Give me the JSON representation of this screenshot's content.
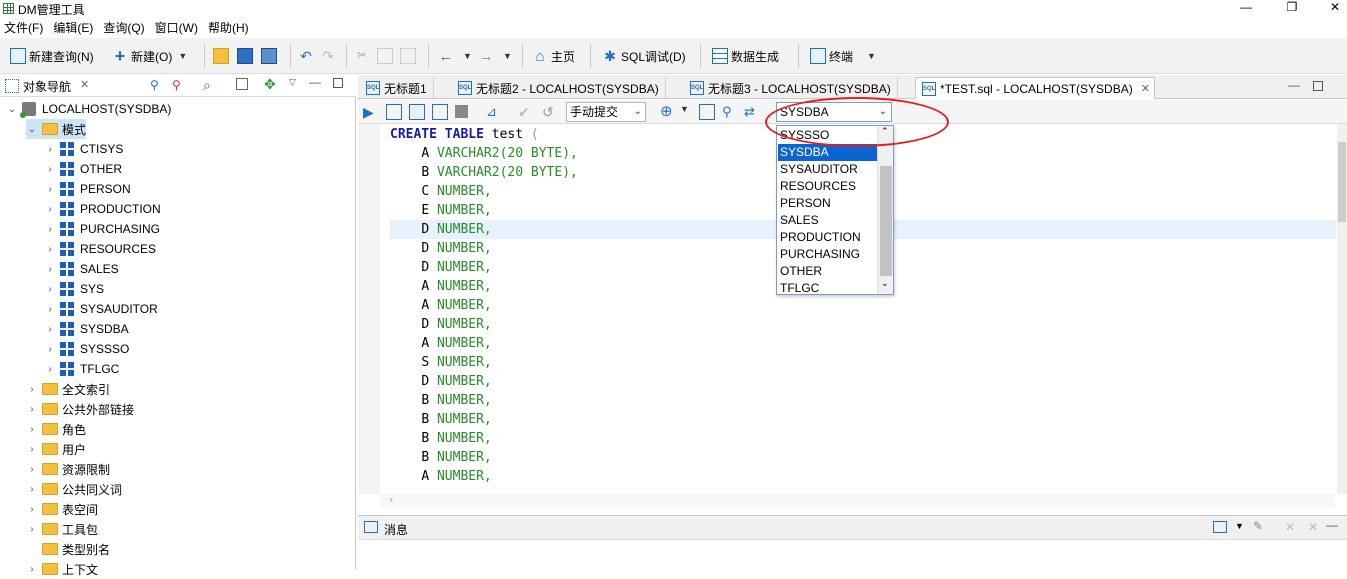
{
  "window": {
    "title": "DM管理工具",
    "minimize": "—",
    "restore": "❐",
    "close": "✕"
  },
  "menu": [
    "文件(F)",
    "编辑(E)",
    "查询(Q)",
    "窗口(W)",
    "帮助(H)"
  ],
  "toolbar": {
    "new_query": "新建查询(N)",
    "new": "新建(O)",
    "home": "主页",
    "sql_debug": "SQL调试(D)",
    "data_gen": "数据生成",
    "terminal": "终端"
  },
  "left_panel": {
    "title": "对象导航",
    "tree": {
      "root": "LOCALHOST(SYSDBA)",
      "schema_folder": "模式",
      "schemas": [
        "CTISYS",
        "OTHER",
        "PERSON",
        "PRODUCTION",
        "PURCHASING",
        "RESOURCES",
        "SALES",
        "SYS",
        "SYSAUDITOR",
        "SYSDBA",
        "SYSSSO",
        "TFLGC"
      ],
      "folders": [
        "全文索引",
        "公共外部链接",
        "角色",
        "用户",
        "资源限制",
        "公共同义词",
        "表空间",
        "工具包",
        "类型别名",
        "上下文"
      ]
    }
  },
  "editor_tabs": [
    {
      "label": "无标题1"
    },
    {
      "label": "无标题2 - LOCALHOST(SYSDBA)"
    },
    {
      "label": "无标题3 - LOCALHOST(SYSDBA)"
    },
    {
      "label": "*TEST.sql - LOCALHOST(SYSDBA)",
      "active": true
    }
  ],
  "editor_toolbar": {
    "commit_mode": "手动提交",
    "schema": "SYSDBA"
  },
  "code": {
    "header": {
      "kw1": "CREATE",
      "kw2": "TABLE",
      "name": "test",
      "paren": "("
    },
    "columns": [
      {
        "name": "A",
        "type": "VARCHAR2(20 BYTE),"
      },
      {
        "name": "B",
        "type": "VARCHAR2(20 BYTE),"
      },
      {
        "name": "C",
        "type": "NUMBER,"
      },
      {
        "name": "E",
        "type": "NUMBER,"
      },
      {
        "name": "D",
        "type": "NUMBER,"
      },
      {
        "name": "D",
        "type": "NUMBER,"
      },
      {
        "name": "D",
        "type": "NUMBER,"
      },
      {
        "name": "A",
        "type": "NUMBER,"
      },
      {
        "name": "A",
        "type": "NUMBER,"
      },
      {
        "name": "D",
        "type": "NUMBER,"
      },
      {
        "name": "A",
        "type": "NUMBER,"
      },
      {
        "name": "S",
        "type": "NUMBER,"
      },
      {
        "name": "D",
        "type": "NUMBER,"
      },
      {
        "name": "B",
        "type": "NUMBER,"
      },
      {
        "name": "B",
        "type": "NUMBER,"
      },
      {
        "name": "B",
        "type": "NUMBER,"
      },
      {
        "name": "B",
        "type": "NUMBER,"
      },
      {
        "name": "A",
        "type": "NUMBER,"
      }
    ]
  },
  "schema_dropdown": {
    "options": [
      "SYSSSO",
      "SYSDBA",
      "SYSAUDITOR",
      "RESOURCES",
      "PERSON",
      "SALES",
      "PRODUCTION",
      "PURCHASING",
      "OTHER",
      "TFLGC"
    ],
    "selected": "SYSDBA"
  },
  "messages": {
    "title": "消息"
  },
  "colors": {
    "accent": "#0a64d2",
    "keyword": "#1a1aa6",
    "type": "#2a8a2a",
    "annotation": "#e02020"
  }
}
